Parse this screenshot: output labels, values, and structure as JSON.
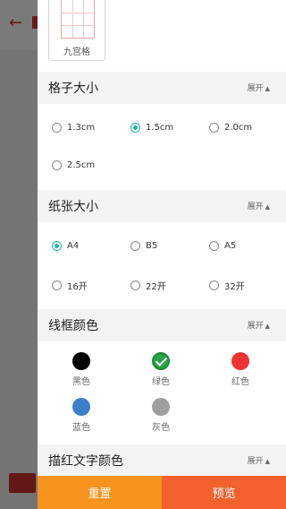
{
  "template": {
    "label": "九宫格"
  },
  "grid_size": {
    "title": "格子大小",
    "toggle": "展开",
    "options": [
      "1.3cm",
      "1.5cm",
      "2.0cm",
      "2.5cm"
    ],
    "selected": "1.5cm"
  },
  "paper_size": {
    "title": "纸张大小",
    "toggle": "展开",
    "options": [
      "A4",
      "B5",
      "A5",
      "16开",
      "22开",
      "32开"
    ],
    "selected": "A4"
  },
  "frame_color": {
    "title": "线框颜色",
    "toggle": "展开",
    "options": [
      {
        "label": "黑色",
        "color": "#000000"
      },
      {
        "label": "绿色",
        "color": "#26a644"
      },
      {
        "label": "红色",
        "color": "#ee3333"
      },
      {
        "label": "蓝色",
        "color": "#3b80c6"
      },
      {
        "label": "灰色",
        "color": "#9e9e9e"
      }
    ],
    "selected": "绿色"
  },
  "trace_color": {
    "title": "描红文字颜色",
    "toggle": "展开"
  },
  "footer": {
    "reset": "重置",
    "preview": "预览"
  },
  "colors": {
    "accent": "#1cb5a4",
    "reset_bg": "#f7941d",
    "preview_bg": "#f2622e"
  }
}
